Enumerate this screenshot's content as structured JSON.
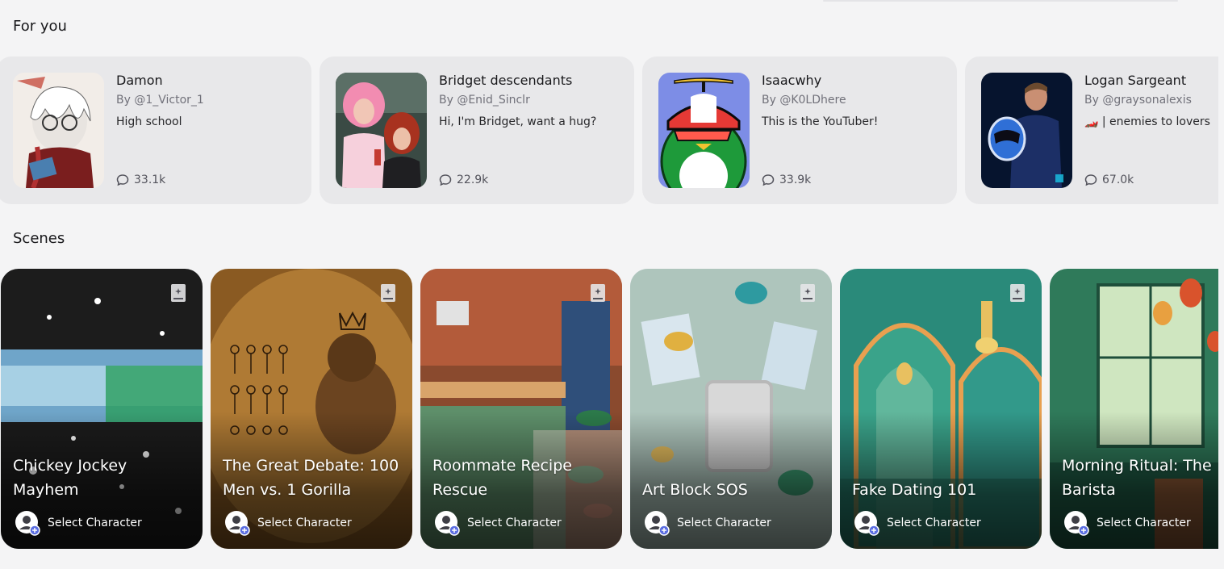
{
  "sections": {
    "for_you_title": "For you",
    "scenes_title": "Scenes"
  },
  "characters": [
    {
      "name": "Damon",
      "author": "By @1_Victor_1",
      "description": "High school",
      "chats": "33.1k"
    },
    {
      "name": "Bridget descendants",
      "author": "By @Enid_Sinclr",
      "description": "Hi, I'm Bridget, want a hug?",
      "chats": "22.9k"
    },
    {
      "name": "Isaacwhy",
      "author": "By @K0LDhere",
      "description": "This is the YouTuber!",
      "chats": "33.9k"
    },
    {
      "name": "Logan Sargeant",
      "author": "By @graysonalexis",
      "description": "🏎️ | enemies to lovers",
      "chats": "67.0k"
    }
  ],
  "scenes": [
    {
      "title": "Chickey Jockey Mayhem",
      "action": "Select Character"
    },
    {
      "title": "The Great Debate: 100 Men vs. 1 Gorilla",
      "action": "Select Character"
    },
    {
      "title": "Roommate Recipe Rescue",
      "action": "Select Character"
    },
    {
      "title": "Art Block SOS",
      "action": "Select Character"
    },
    {
      "title": "Fake Dating 101",
      "action": "Select Character"
    },
    {
      "title": "Morning Ritual: The Barista",
      "action": "Select Character"
    }
  ],
  "colors": {
    "background": "#f4f4f5",
    "card": "#e8e8ea",
    "avatar_plus_badge": "#5b6ee1"
  },
  "icons": {
    "chat": "chat-bubble-icon",
    "scene_badge": "book-sparkle-icon",
    "select": "user-plus-icon"
  }
}
